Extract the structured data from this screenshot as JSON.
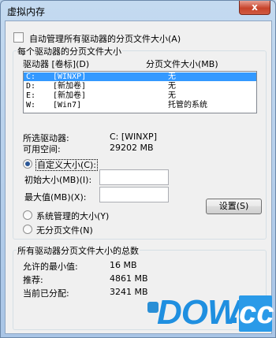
{
  "window": {
    "title": "虚拟内存",
    "close_glyph": "x"
  },
  "auto_manage": {
    "label": "自动管理所有驱动器的分页文件大小(A)",
    "checked": false
  },
  "drives_group": {
    "legend": "每个驱动器的分页文件大小",
    "header_drive": "驱动器 [卷标](D)",
    "header_size": "分页文件大小(MB)",
    "rows": [
      {
        "drive": "C:",
        "label": "[WINXP]",
        "size": "无",
        "selected": true
      },
      {
        "drive": "D:",
        "label": "[新加卷]",
        "size": "无",
        "selected": false
      },
      {
        "drive": "E:",
        "label": "[新加卷]",
        "size": "无",
        "selected": false
      },
      {
        "drive": "W:",
        "label": "[Win7]",
        "size": "托管的系统",
        "selected": false
      }
    ],
    "selected_drive_label": "所选驱动器:",
    "selected_drive_value": "C:  [WINXP]",
    "free_space_label": "可用空间:",
    "free_space_value": "29202 MB",
    "custom_size_label": "自定义大小(C):",
    "initial_size_label": "初始大小(MB)(I):",
    "initial_size_value": "",
    "max_size_label": "最大值(MB)(X):",
    "max_size_value": "",
    "system_managed_label": "系统管理的大小(Y)",
    "no_paging_label": "无分页文件(N)",
    "set_button": "设置(S)",
    "selected_option": "custom"
  },
  "total_group": {
    "legend": "所有驱动器分页文件大小的总数",
    "min_label": "允许的最小值:",
    "min_value": "16 MB",
    "recommended_label": "推荐:",
    "recommended_value": "4861 MB",
    "current_label": "当前已分配:",
    "current_value": "3241 MB"
  },
  "watermark": {
    "text": "DOWN",
    "suffix": "cc"
  },
  "colors": {
    "selection": "#3399ff",
    "watermark": "#1f8fe0",
    "close": "#c7432b"
  }
}
